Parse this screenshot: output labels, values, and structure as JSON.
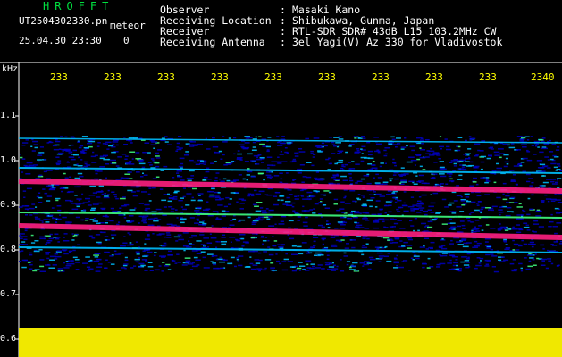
{
  "header": {
    "app_title": "HROFFT",
    "file_name": "UT2504302330.pn",
    "meteor_label": "meteor",
    "date_time": "25.04.30 23:30",
    "count": "0_"
  },
  "info": [
    {
      "label": "Observer",
      "value": "Masaki Kano"
    },
    {
      "label": "Receiving Location",
      "value": "Shibukawa, Gunma, Japan"
    },
    {
      "label": "Receiver",
      "value": "RTL-SDR SDR# 43dB L15 103.2MHz CW"
    },
    {
      "label": "Receiving Antenna",
      "value": "3el Yagi(V) Az 330 for Vladivostok"
    }
  ],
  "axis": {
    "unit": "kHz",
    "x_ticks": [
      "233",
      "233",
      "233",
      "233",
      "233",
      "233",
      "233",
      "233",
      "233",
      "2340"
    ],
    "y_ticks": [
      "1.1",
      "1.0",
      "0.9",
      "0.8",
      "0.7",
      "0.6"
    ]
  },
  "colors": {
    "background": "#000000",
    "title": "#00e040",
    "tick": "#ffff00",
    "signal_peak": "#ff2080",
    "noise_low": "#0000c0",
    "noise_mid": "#00c0ff"
  }
}
